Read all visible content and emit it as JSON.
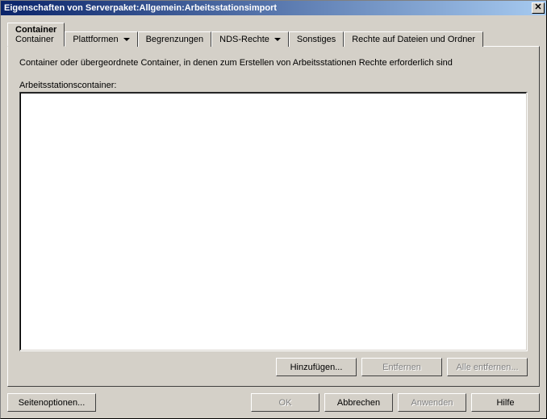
{
  "title": "Eigenschaften von Serverpaket:Allgemein:Arbeitsstationsimport",
  "tabs": {
    "container": {
      "label": "Container",
      "sub": "Container"
    },
    "plattformen": {
      "label": "Plattformen"
    },
    "begrenzungen": {
      "label": "Begrenzungen"
    },
    "nds_rechte": {
      "label": "NDS-Rechte"
    },
    "sonstiges": {
      "label": "Sonstiges"
    },
    "rechte_dateien": {
      "label": "Rechte auf Dateien und Ordner"
    }
  },
  "panel": {
    "description": "Container oder übergeordnete Container, in denen zum Erstellen von Arbeitsstationen Rechte erforderlich sind",
    "list_label": "Arbeitsstationscontainer:",
    "buttons": {
      "add": "Hinzufügen...",
      "remove": "Entfernen",
      "remove_all": "Alle entfernen..."
    }
  },
  "footer": {
    "page_options": "Seitenoptionen...",
    "ok": "OK",
    "cancel": "Abbrechen",
    "apply": "Anwenden",
    "help": "Hilfe"
  }
}
